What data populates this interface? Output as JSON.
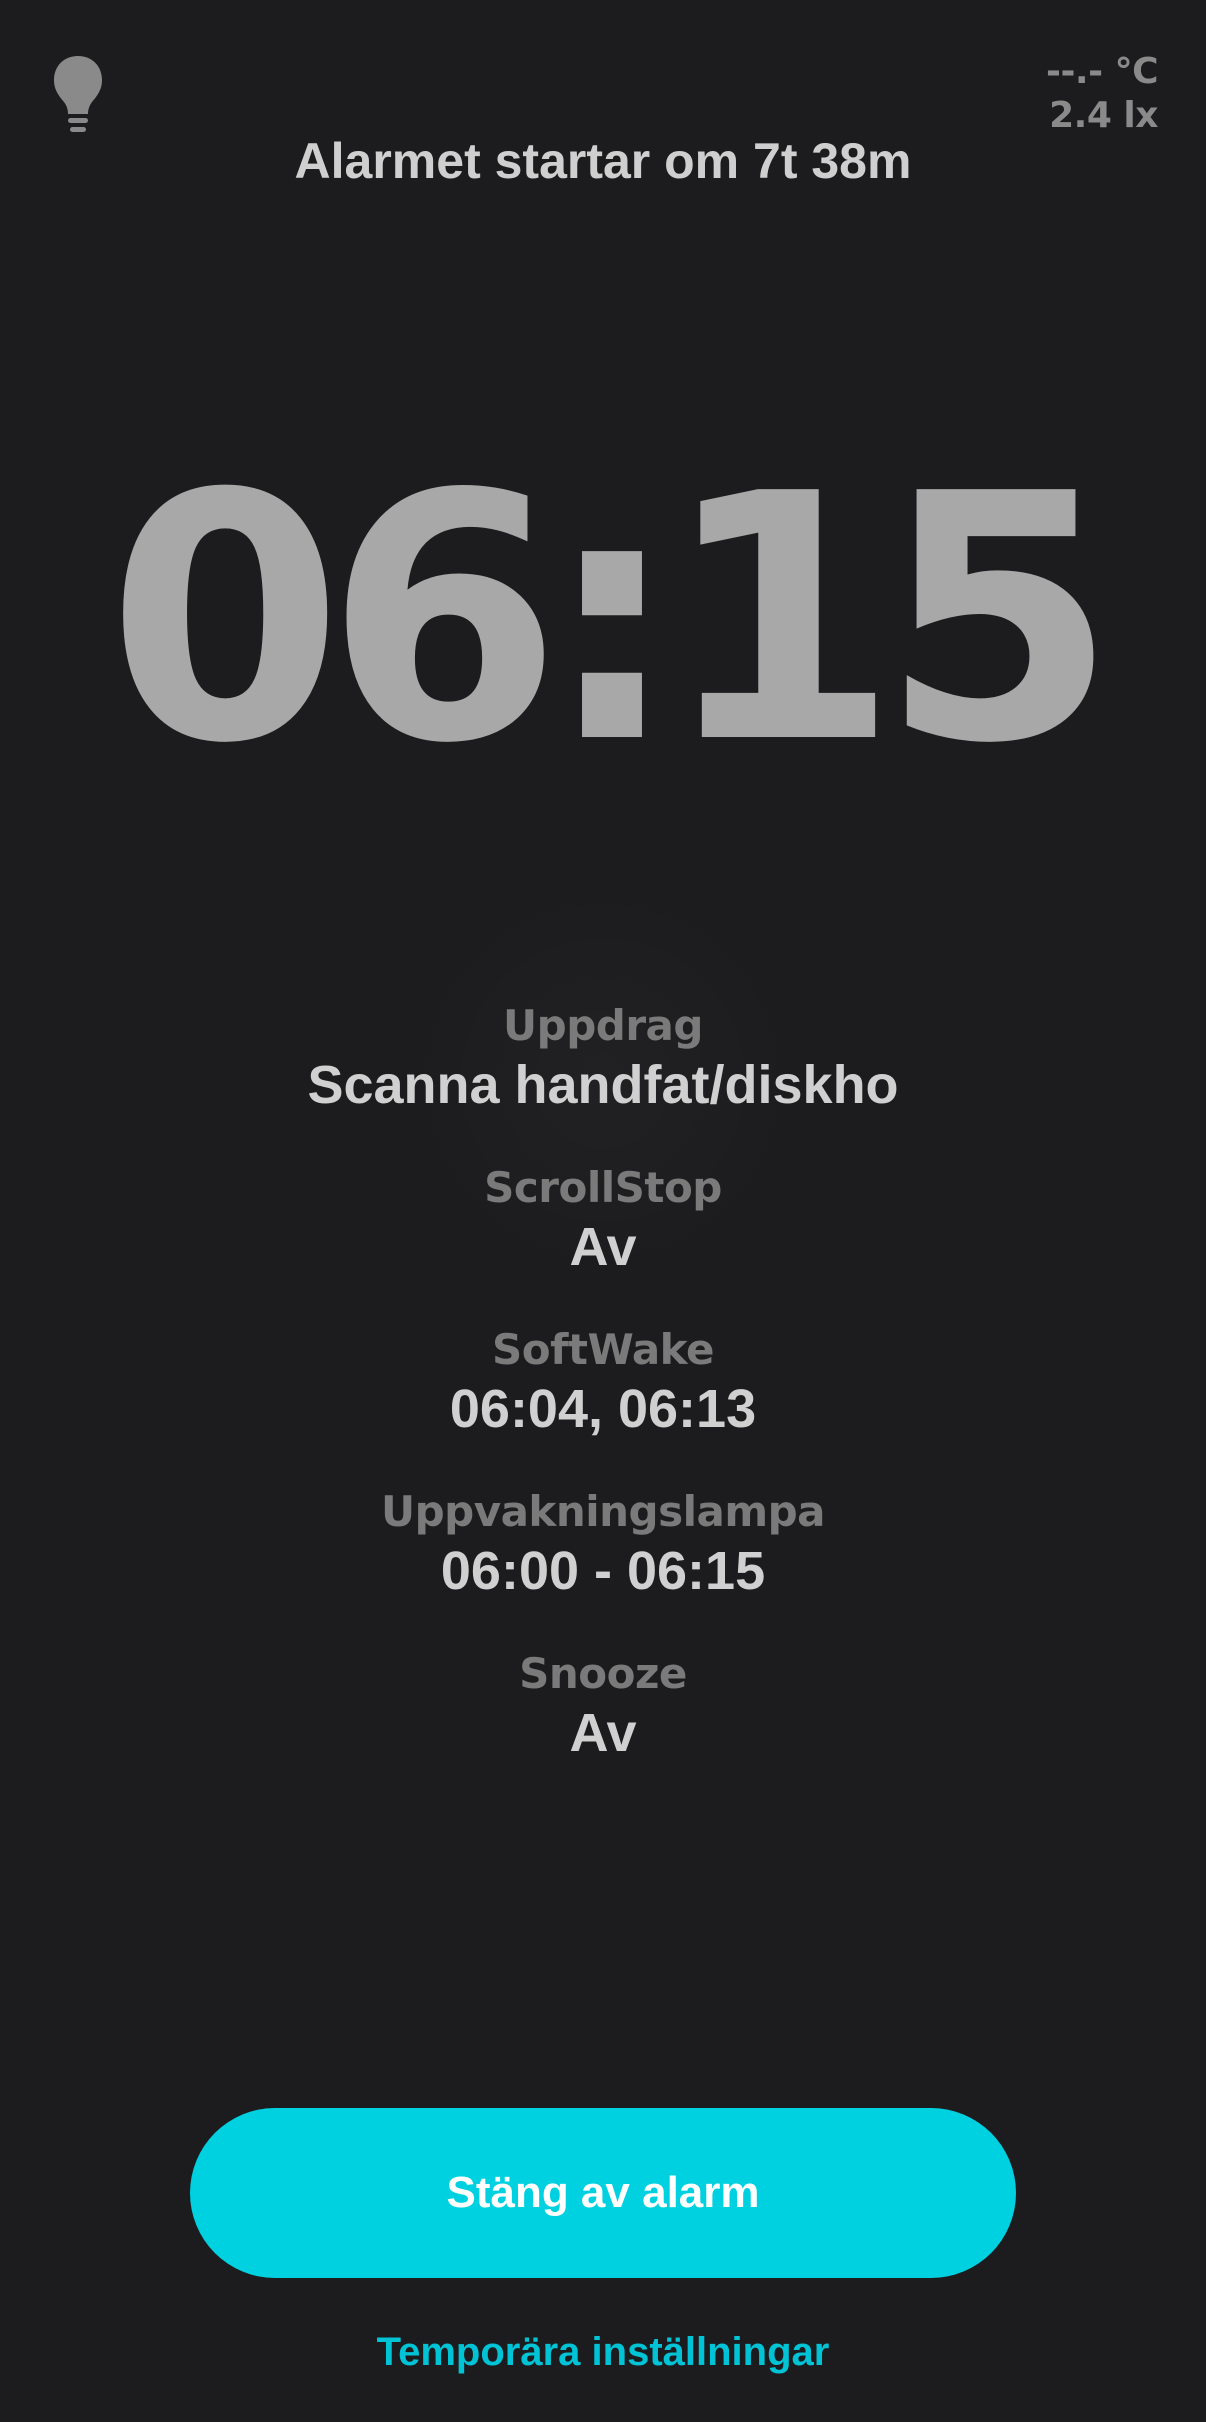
{
  "header": {
    "sensor_temp": "--.- °C",
    "sensor_lux": "2.4 lx",
    "countdown": "Alarmet startar om 7t 38m"
  },
  "icons": {
    "top_left": "lightbulb-icon"
  },
  "alarm": {
    "time": "06:15"
  },
  "details": [
    {
      "label": "Uppdrag",
      "value": "Scanna handfat/diskho"
    },
    {
      "label": "ScrollStop",
      "value": "Av"
    },
    {
      "label": "SoftWake",
      "value": "06:04, 06:13"
    },
    {
      "label": "Uppvakningslampa",
      "value": "06:00 - 06:15"
    },
    {
      "label": "Snooze",
      "value": "Av"
    }
  ],
  "actions": {
    "dismiss_label": "Stäng av alarm",
    "temp_settings_label": "Temporära inställningar"
  },
  "colors": {
    "background": "#1c1c1e",
    "accent": "#00d1e0",
    "clock": "#a8a8a8"
  }
}
